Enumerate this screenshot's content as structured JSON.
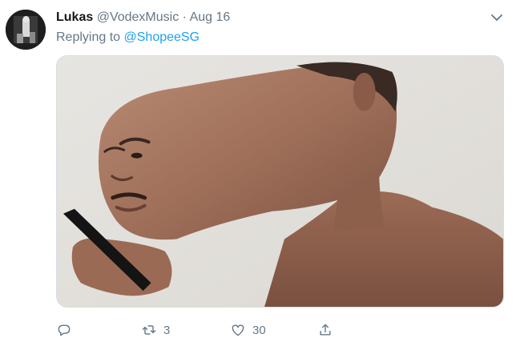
{
  "tweet": {
    "display_name": "Lukas",
    "handle": "@VodexMusic",
    "separator": "·",
    "date": "Aug 16",
    "replying_prefix": "Replying to",
    "replying_to": "@ShopeeSG"
  },
  "actions": {
    "reply": {
      "icon": "reply-icon",
      "count": ""
    },
    "retweet": {
      "icon": "retweet-icon",
      "count": "3"
    },
    "like": {
      "icon": "heart-icon",
      "count": "30"
    },
    "share": {
      "icon": "share-icon",
      "count": ""
    }
  },
  "colors": {
    "link": "#1da1f2",
    "secondary_text": "#657786",
    "primary_text": "#14171a"
  }
}
